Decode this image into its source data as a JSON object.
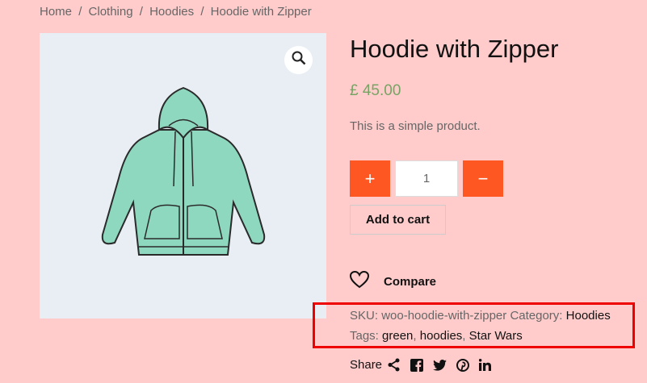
{
  "breadcrumb": {
    "items": [
      "Home",
      "Clothing",
      "Hoodies"
    ],
    "current": "Hoodie with Zipper",
    "separator": "/"
  },
  "product": {
    "title": "Hoodie with Zipper",
    "price": "£ 45.00",
    "description": "This is a simple product.",
    "quantity": "1",
    "plus_label": "+",
    "minus_label": "−",
    "add_to_cart_label": "Add to cart",
    "compare_label": "Compare"
  },
  "meta": {
    "sku_label": "SKU:",
    "sku_value": "woo-hoodie-with-zipper",
    "category_label": "Category:",
    "category_value": "Hoodies",
    "tags_label": "Tags:",
    "tags": [
      "green",
      "hoodies",
      "Star Wars"
    ]
  },
  "share": {
    "label": "Share",
    "icons": [
      "share-icon",
      "facebook-icon",
      "twitter-icon",
      "pinterest-icon",
      "linkedin-icon"
    ]
  },
  "colors": {
    "background": "#ffcccb",
    "accent": "#ff5722",
    "price": "#77a464",
    "highlight_border": "#e00000",
    "hoodie": "#8fd8c0"
  }
}
